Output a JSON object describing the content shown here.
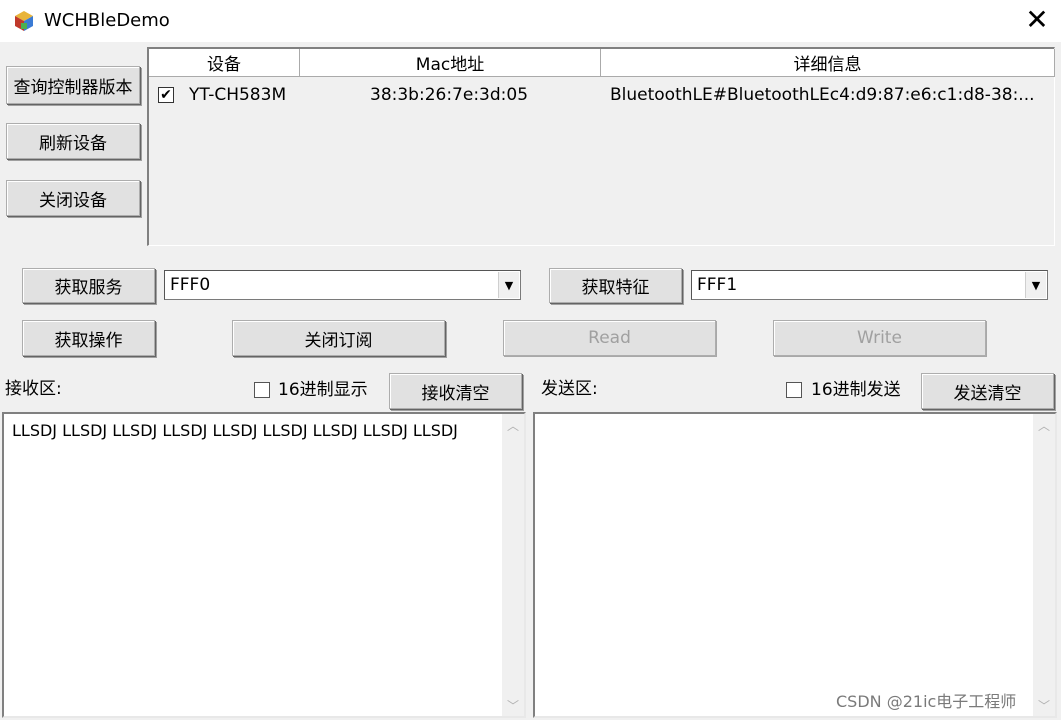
{
  "window": {
    "title": "WCHBleDemo",
    "close_glyph": "✕"
  },
  "sidebar": {
    "query_version": "查询控制器版本",
    "refresh_devices": "刷新设备",
    "close_device": "关闭设备"
  },
  "device_list": {
    "columns": [
      "设备",
      "Mac地址",
      "详细信息"
    ],
    "rows": [
      {
        "checked": true,
        "name": "YT-CH583M",
        "mac": "38:3b:26:7e:3d:05",
        "detail": "BluetoothLE#BluetoothLEc4:d9:87:e6:c1:d8-38:..."
      }
    ]
  },
  "service": {
    "button": "获取服务",
    "value": "FFF0"
  },
  "characteristic": {
    "button": "获取特征",
    "value": "FFF1"
  },
  "actions": {
    "get_ops": "获取操作",
    "unsubscribe": "关闭订阅",
    "read": "Read",
    "write": "Write"
  },
  "receive": {
    "label": "接收区:",
    "hex_label": "16进制显示",
    "clear_button": "接收清空",
    "text": "LLSDJ LLSDJ LLSDJ LLSDJ LLSDJ LLSDJ LLSDJ LLSDJ LLSDJ"
  },
  "send": {
    "label": "发送区:",
    "hex_label": "16进制发送",
    "clear_button": "发送清空",
    "text": ""
  },
  "watermark": "CSDN @21ic电子工程师"
}
